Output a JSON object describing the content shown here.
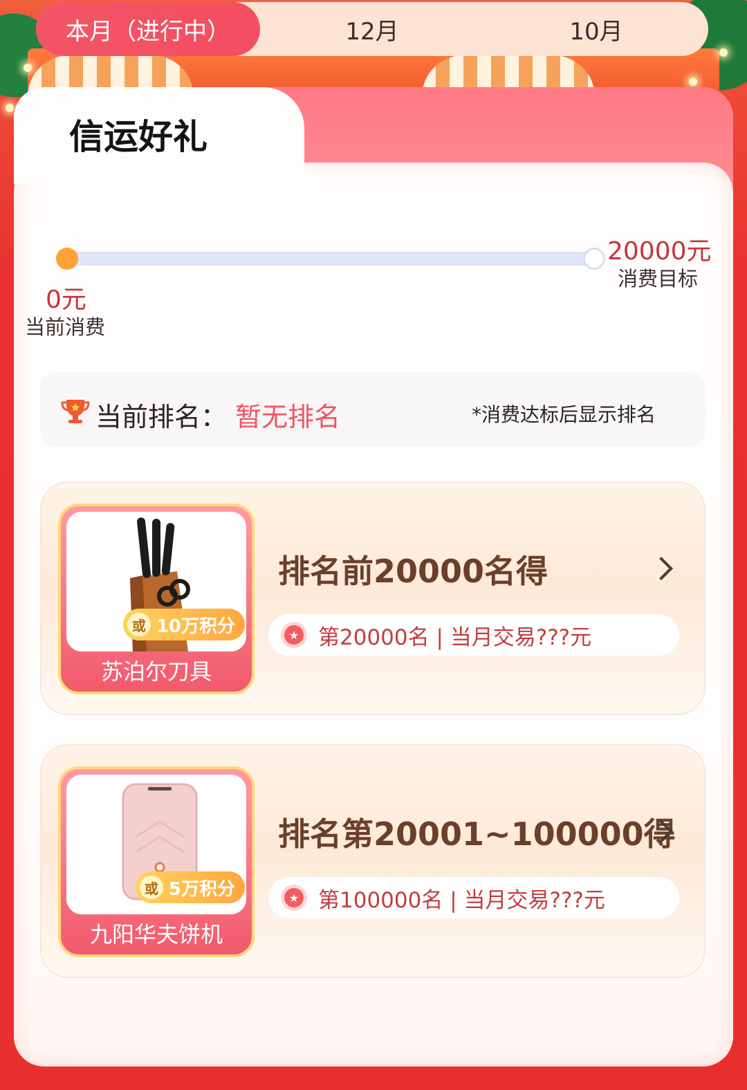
{
  "tabs": [
    {
      "label": "本月（进行中）",
      "active": true
    },
    {
      "label": "12月",
      "active": false
    },
    {
      "label": "10月",
      "active": false
    }
  ],
  "section_title": "信运好礼",
  "progress": {
    "current_value": "0元",
    "current_label": "当前消费",
    "goal_value": "20000元",
    "goal_label": "消费目标",
    "fraction": 0
  },
  "rank": {
    "label": "当前排名：",
    "value": "暂无排名",
    "note": "*消费达标后显示排名"
  },
  "prizes": [
    {
      "title": "排名前20000名得",
      "condition": "第20000名 | 当月交易???元",
      "item_name": "苏泊尔刀具",
      "or_text": "或",
      "points": "10万积分"
    },
    {
      "title": "排名第20001~100000得",
      "condition": "第100000名 | 当月交易???元",
      "item_name": "九阳华夫饼机",
      "or_text": "或",
      "points": "5万积分"
    }
  ],
  "colors": {
    "accent": "#f15566",
    "price_red": "#c8333a",
    "progress_start": "#ffa236",
    "track": "#dfe5f5"
  }
}
